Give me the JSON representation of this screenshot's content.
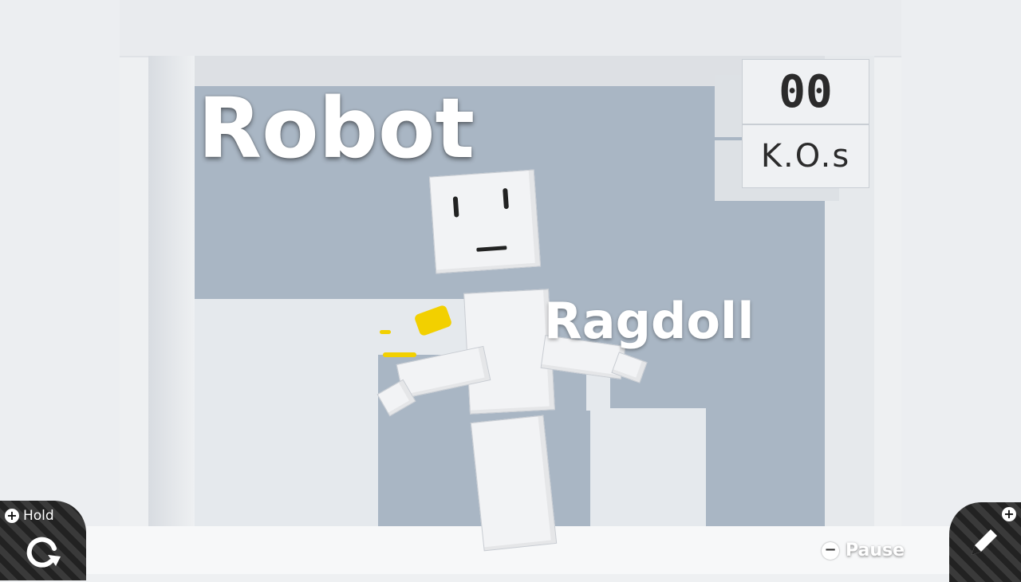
{
  "game": {
    "title": "Robot",
    "subtitle": "Ragdoll"
  },
  "scoreboard": {
    "count": "00",
    "label": "K.O.s"
  },
  "controls": {
    "hold_label": "Hold",
    "pause_label": "Pause",
    "hold_icon": "rotate-icon",
    "edit_icon": "pencil-icon"
  },
  "colors": {
    "wall": "#a9b6c4",
    "doodle": "#f2d000",
    "corner_button": "#222222"
  }
}
